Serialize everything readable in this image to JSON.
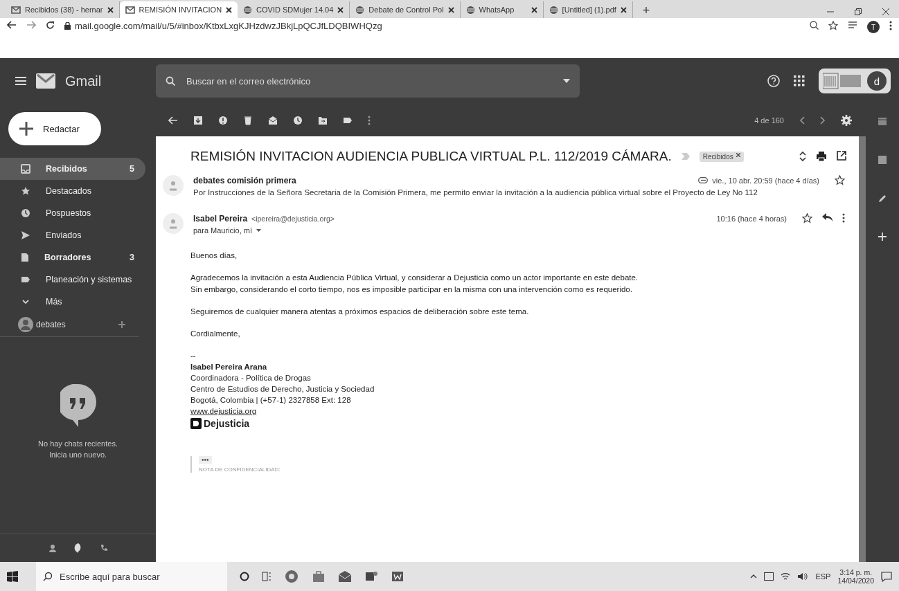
{
  "browser": {
    "tabs": [
      {
        "label": "Recibidos (38) - hernar",
        "selected": false
      },
      {
        "label": "REMISIÓN INVITACION",
        "selected": true
      },
      {
        "label": "COVID SDMujer 14.04",
        "selected": false
      },
      {
        "label": "Debate de Control Pol",
        "selected": false
      },
      {
        "label": "WhatsApp",
        "selected": false
      },
      {
        "label": "[Untitled] (1).pdf",
        "selected": false
      }
    ],
    "new_tab": "+",
    "address": "mail.google.com/mail/u/5/#inbox/KtbxLxgKJHzdwzJBkjLpQCJfLDQBIWHQzg",
    "profile_initial": "T"
  },
  "gmail": {
    "app_name": "Gmail",
    "search": {
      "placeholder": "Buscar en el correo electrónico"
    },
    "account_initial": "d",
    "compose": "Redactar",
    "nav": [
      {
        "label": "Recibidos",
        "count": "5",
        "selected": true,
        "unread": true
      },
      {
        "label": "Destacados",
        "selected": false,
        "unread": false
      },
      {
        "label": "Pospuestos",
        "selected": false,
        "unread": false
      },
      {
        "label": "Enviados",
        "selected": false,
        "unread": false
      },
      {
        "label": "Borradores",
        "count": "3",
        "selected": false,
        "unread": true
      },
      {
        "label": "Planeación y sistemas",
        "selected": false,
        "unread": false
      },
      {
        "label": "Más",
        "selected": false,
        "unread": false
      }
    ],
    "hangouts_user": "debates",
    "chats_empty": [
      "No hay chats recientes.",
      "Inicia uno nuevo."
    ],
    "pager": "4 de 160",
    "thread": {
      "subject": "REMISIÓN INVITACION AUDIENCIA PUBLICA VIRTUAL P.L. 112/2019 CÁMARA.",
      "label": "Recibidos",
      "messages": [
        {
          "sender": "debates comisión primera",
          "snippet": "Por Instrucciones de la Señora Secretaria de la Comisión Primera, me permito enviar la invitación a la audiencia pública virtual sobre el Proyecto de Ley No 112",
          "date": "vie., 10 abr. 20:59 (hace 4 días)",
          "attachment": true,
          "starred": false
        },
        {
          "sender": "Isabel Pereira",
          "email": "<ipereira@dejusticia.org>",
          "recipients": "para Mauricio, mí",
          "date": "10:16 (hace 4 horas)",
          "attachment": false,
          "starred": false
        }
      ],
      "body": [
        "Buenos días,",
        "Agradecemos la invitación a esta Audiencia Pública Virtual, y considerar a Dejusticia como un actor importante en este debate.\nSin embargo, considerando el corto tiempo, nos es imposible participar en la misma con una intervención como es requerido.",
        "Seguiremos de cualquier manera atentas a próximos espacios de deliberación sobre este tema.",
        "Cordialmente,"
      ],
      "signature": {
        "dash": "--",
        "name": "Isabel Pereira Arana",
        "lines": [
          "Coordinadora - Política de Drogas",
          "Centro de Estudios de Derecho, Justicia y Sociedad",
          "Bogotá, Colombia | (+57-1) 2327858 Ext: 128"
        ],
        "link": "www.dejusticia.org",
        "logo": "Dejusticia"
      },
      "quoted_toggle": "•••",
      "footer_note": "NOTA DE CONFIDENCIALIDAD:"
    }
  },
  "taskbar": {
    "search_placeholder": "Escribe aquí para buscar",
    "language": "ESP",
    "time": "3:14 p. m.",
    "date": "14/04/2020"
  }
}
